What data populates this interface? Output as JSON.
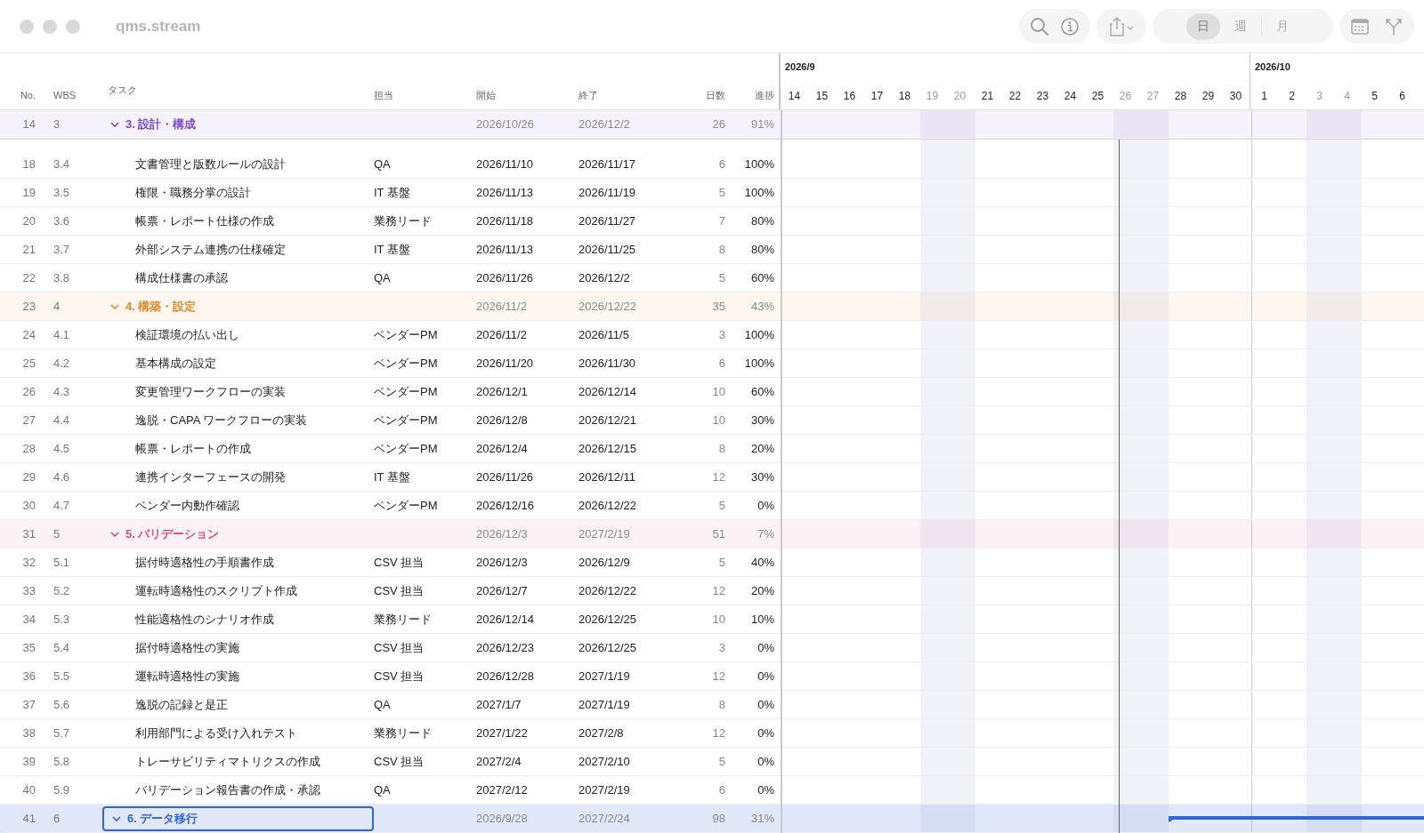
{
  "window": {
    "title": "qms.stream"
  },
  "toolbar": {
    "view_modes": [
      {
        "label": "日",
        "selected": true
      },
      {
        "label": "週",
        "selected": false
      },
      {
        "label": "月",
        "selected": false
      }
    ]
  },
  "table": {
    "columns": [
      "No.",
      "WBS",
      "タスク",
      "担当",
      "開始",
      "終了",
      "日数",
      "進捗"
    ],
    "pinned_row": {
      "no": "14",
      "wbs": "3",
      "task": "3. 設計・構成",
      "start": "2026/10/26",
      "end": "2026/12/2",
      "days": "26",
      "progress": "91%",
      "kind": "group",
      "color": "#7b48d6",
      "expanded": true,
      "selected": false
    },
    "rows": [
      {
        "no": "18",
        "wbs": "3.4",
        "task": "文書管理と版数ルールの設計",
        "assignee": "QA",
        "start": "2026/11/10",
        "end": "2026/11/17",
        "days": "6",
        "progress": "100%",
        "kind": "task",
        "selected": false
      },
      {
        "no": "19",
        "wbs": "3.5",
        "task": "権限・職務分掌の設計",
        "assignee": "IT 基盤",
        "start": "2026/11/13",
        "end": "2026/11/19",
        "days": "5",
        "progress": "100%",
        "kind": "task",
        "selected": false
      },
      {
        "no": "20",
        "wbs": "3.6",
        "task": "帳票・レポート仕様の作成",
        "assignee": "業務リード",
        "start": "2026/11/18",
        "end": "2026/11/27",
        "days": "7",
        "progress": "80%",
        "kind": "task",
        "selected": false
      },
      {
        "no": "21",
        "wbs": "3.7",
        "task": "外部システム連携の仕様確定",
        "assignee": "IT 基盤",
        "start": "2026/11/13",
        "end": "2026/11/25",
        "days": "8",
        "progress": "80%",
        "kind": "task",
        "selected": false
      },
      {
        "no": "22",
        "wbs": "3.8",
        "task": "構成仕様書の承認",
        "assignee": "QA",
        "start": "2026/11/26",
        "end": "2026/12/2",
        "days": "5",
        "progress": "60%",
        "kind": "task",
        "selected": false
      },
      {
        "no": "23",
        "wbs": "4",
        "task": "4. 構築・設定",
        "start": "2026/11/2",
        "end": "2026/12/22",
        "days": "35",
        "progress": "43%",
        "kind": "group",
        "color": "#e08a30",
        "expanded": true,
        "selected": false
      },
      {
        "no": "24",
        "wbs": "4.1",
        "task": "検証環境の払い出し",
        "assignee": "ベンダーPM",
        "start": "2026/11/2",
        "end": "2026/11/5",
        "days": "3",
        "progress": "100%",
        "kind": "task",
        "selected": false
      },
      {
        "no": "25",
        "wbs": "4.2",
        "task": "基本構成の設定",
        "assignee": "ベンダーPM",
        "start": "2026/11/20",
        "end": "2026/11/30",
        "days": "6",
        "progress": "100%",
        "kind": "task",
        "selected": false
      },
      {
        "no": "26",
        "wbs": "4.3",
        "task": "変更管理ワークフローの実装",
        "assignee": "ベンダーPM",
        "start": "2026/12/1",
        "end": "2026/12/14",
        "days": "10",
        "progress": "60%",
        "kind": "task",
        "selected": false
      },
      {
        "no": "27",
        "wbs": "4.4",
        "task": "逸脱・CAPA ワークフローの実装",
        "assignee": "ベンダーPM",
        "start": "2026/12/8",
        "end": "2026/12/21",
        "days": "10",
        "progress": "30%",
        "kind": "task",
        "selected": false
      },
      {
        "no": "28",
        "wbs": "4.5",
        "task": "帳票・レポートの作成",
        "assignee": "ベンダーPM",
        "start": "2026/12/4",
        "end": "2026/12/15",
        "days": "8",
        "progress": "20%",
        "kind": "task",
        "selected": false
      },
      {
        "no": "29",
        "wbs": "4.6",
        "task": "連携インターフェースの開発",
        "assignee": "IT 基盤",
        "start": "2026/11/26",
        "end": "2026/12/11",
        "days": "12",
        "progress": "30%",
        "kind": "task",
        "selected": false
      },
      {
        "no": "30",
        "wbs": "4.7",
        "task": "ベンダー内動作確認",
        "assignee": "ベンダーPM",
        "start": "2026/12/16",
        "end": "2026/12/22",
        "days": "5",
        "progress": "0%",
        "kind": "task",
        "selected": false
      },
      {
        "no": "31",
        "wbs": "5",
        "task": "5. バリデーション",
        "start": "2026/12/3",
        "end": "2027/2/19",
        "days": "51",
        "progress": "7%",
        "kind": "group",
        "color": "#d94c86",
        "expanded": true,
        "selected": false
      },
      {
        "no": "32",
        "wbs": "5.1",
        "task": "据付時適格性の手順書作成",
        "assignee": "CSV 担当",
        "start": "2026/12/3",
        "end": "2026/12/9",
        "days": "5",
        "progress": "40%",
        "kind": "task",
        "selected": false
      },
      {
        "no": "33",
        "wbs": "5.2",
        "task": "運転時適格性のスクリプト作成",
        "assignee": "CSV 担当",
        "start": "2026/12/7",
        "end": "2026/12/22",
        "days": "12",
        "progress": "20%",
        "kind": "task",
        "selected": false
      },
      {
        "no": "34",
        "wbs": "5.3",
        "task": "性能適格性のシナリオ作成",
        "assignee": "業務リード",
        "start": "2026/12/14",
        "end": "2026/12/25",
        "days": "10",
        "progress": "10%",
        "kind": "task",
        "selected": false
      },
      {
        "no": "35",
        "wbs": "5.4",
        "task": "据付時適格性の実施",
        "assignee": "CSV 担当",
        "start": "2026/12/23",
        "end": "2026/12/25",
        "days": "3",
        "progress": "0%",
        "kind": "task",
        "selected": false
      },
      {
        "no": "36",
        "wbs": "5.5",
        "task": "運転時適格性の実施",
        "assignee": "CSV 担当",
        "start": "2026/12/28",
        "end": "2027/1/19",
        "days": "12",
        "progress": "0%",
        "kind": "task",
        "selected": false
      },
      {
        "no": "37",
        "wbs": "5.6",
        "task": "逸脱の記録と是正",
        "assignee": "QA",
        "start": "2027/1/7",
        "end": "2027/1/19",
        "days": "8",
        "progress": "0%",
        "kind": "task",
        "selected": false
      },
      {
        "no": "38",
        "wbs": "5.7",
        "task": "利用部門による受け入れテスト",
        "assignee": "業務リード",
        "start": "2027/1/22",
        "end": "2027/2/8",
        "days": "12",
        "progress": "0%",
        "kind": "task",
        "selected": false
      },
      {
        "no": "39",
        "wbs": "5.8",
        "task": "トレーサビリティマトリクスの作成",
        "assignee": "CSV 担当",
        "start": "2027/2/4",
        "end": "2027/2/10",
        "days": "5",
        "progress": "0%",
        "kind": "task",
        "selected": false
      },
      {
        "no": "40",
        "wbs": "5.9",
        "task": "バリデーション報告書の作成・承認",
        "assignee": "QA",
        "start": "2027/2/12",
        "end": "2027/2/19",
        "days": "6",
        "progress": "0%",
        "kind": "task",
        "selected": false
      },
      {
        "no": "41",
        "wbs": "6",
        "task": "6. データ移行",
        "start": "2026/9/28",
        "end": "2027/2/24",
        "days": "98",
        "progress": "31%",
        "kind": "group",
        "color": "#3563d8",
        "expanded": true,
        "selected": true
      }
    ]
  },
  "timeline": {
    "months": [
      {
        "label": "2026/9",
        "days": [
          {
            "label": "14",
            "weekend": false,
            "today": false
          },
          {
            "label": "15",
            "weekend": false,
            "today": false
          },
          {
            "label": "16",
            "weekend": false,
            "today": false
          },
          {
            "label": "17",
            "weekend": false,
            "today": false
          },
          {
            "label": "18",
            "weekend": false,
            "today": false
          },
          {
            "label": "19",
            "weekend": true,
            "today": false
          },
          {
            "label": "20",
            "weekend": true,
            "today": false
          },
          {
            "label": "21",
            "weekend": false,
            "today": false
          },
          {
            "label": "22",
            "weekend": false,
            "today": false
          },
          {
            "label": "23",
            "weekend": false,
            "today": false
          },
          {
            "label": "24",
            "weekend": false,
            "today": false
          },
          {
            "label": "25",
            "weekend": false,
            "today": false
          },
          {
            "label": "26",
            "weekend": true,
            "today": true
          },
          {
            "label": "27",
            "weekend": true,
            "today": false
          },
          {
            "label": "28",
            "weekend": false,
            "today": false
          },
          {
            "label": "29",
            "weekend": false,
            "today": false
          },
          {
            "label": "30",
            "weekend": false,
            "today": false
          }
        ]
      },
      {
        "label": "2026/10",
        "days": [
          {
            "label": "1",
            "weekend": false,
            "today": false
          },
          {
            "label": "2",
            "weekend": false,
            "today": false
          },
          {
            "label": "3",
            "weekend": true,
            "today": false
          },
          {
            "label": "4",
            "weekend": true,
            "today": false
          },
          {
            "label": "5",
            "weekend": false,
            "today": false
          },
          {
            "label": "6",
            "weekend": false,
            "today": false
          }
        ]
      }
    ]
  }
}
